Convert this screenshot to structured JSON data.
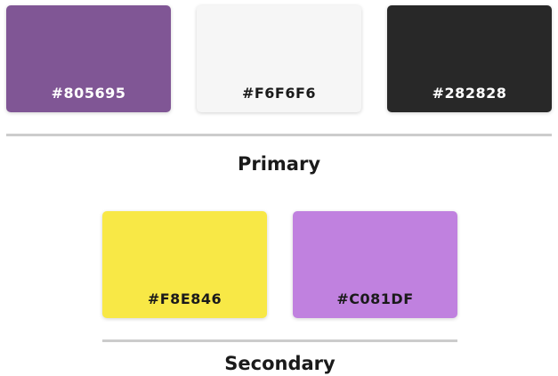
{
  "primary": {
    "label": "Primary",
    "swatches": [
      {
        "hex": "#805695",
        "color": "#805695",
        "text_color": "#ffffff"
      },
      {
        "hex": "#F6F6F6",
        "color": "#F6F6F6",
        "text_color": "#1a1a1a"
      },
      {
        "hex": "#282828",
        "color": "#282828",
        "text_color": "#ffffff"
      }
    ]
  },
  "secondary": {
    "label": "Secondary",
    "swatches": [
      {
        "hex": "#F8E846",
        "color": "#F8E846",
        "text_color": "#1a1a1a"
      },
      {
        "hex": "#C081DF",
        "color": "#C081DF",
        "text_color": "#1a1a1a"
      }
    ]
  },
  "divider_color": "#cccccc"
}
